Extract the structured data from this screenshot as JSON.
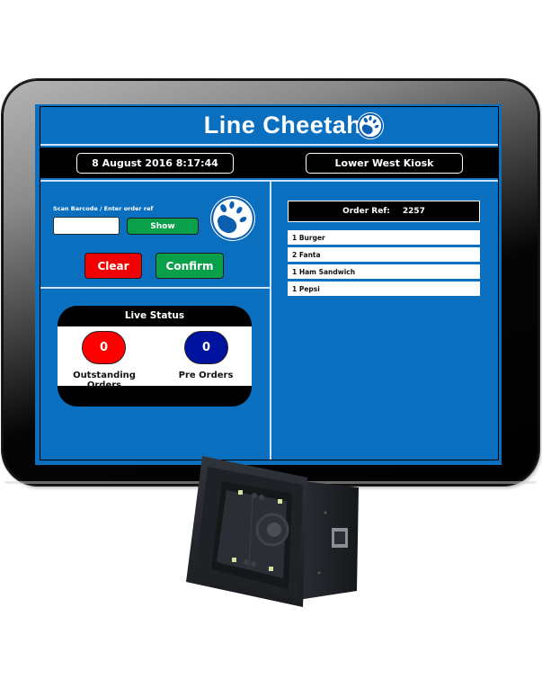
{
  "app": {
    "title": "Line Cheetah",
    "logo_icon": "paw-print-icon"
  },
  "info_bar": {
    "datetime": "8 August 2016 8:17:44",
    "location": "Lower West Kiosk"
  },
  "scan": {
    "label": "Scan Barcode / Enter order ref",
    "input_value": "",
    "input_placeholder": "",
    "show_label": "Show",
    "clear_label": "Clear",
    "confirm_label": "Confirm"
  },
  "live_status": {
    "title": "Live Status",
    "outstanding": {
      "count": "0",
      "label": "Outstanding Orders"
    },
    "pre_orders": {
      "count": "0",
      "label": "Pre Orders"
    }
  },
  "order": {
    "ref_label": "Order Ref:",
    "ref_value": "2257",
    "items": [
      "1 Burger",
      "2 Fanta",
      "1 Ham Sandwich",
      "1 Pepsi"
    ]
  },
  "colors": {
    "screen_blue": "#0b6fc0",
    "button_green": "#0aa04a",
    "button_red": "#f00000",
    "pre_orders_blue": "#00139e",
    "outstanding_red": "#ff0000"
  },
  "device": {
    "accessory_icon": "barcode-scanner-icon"
  }
}
